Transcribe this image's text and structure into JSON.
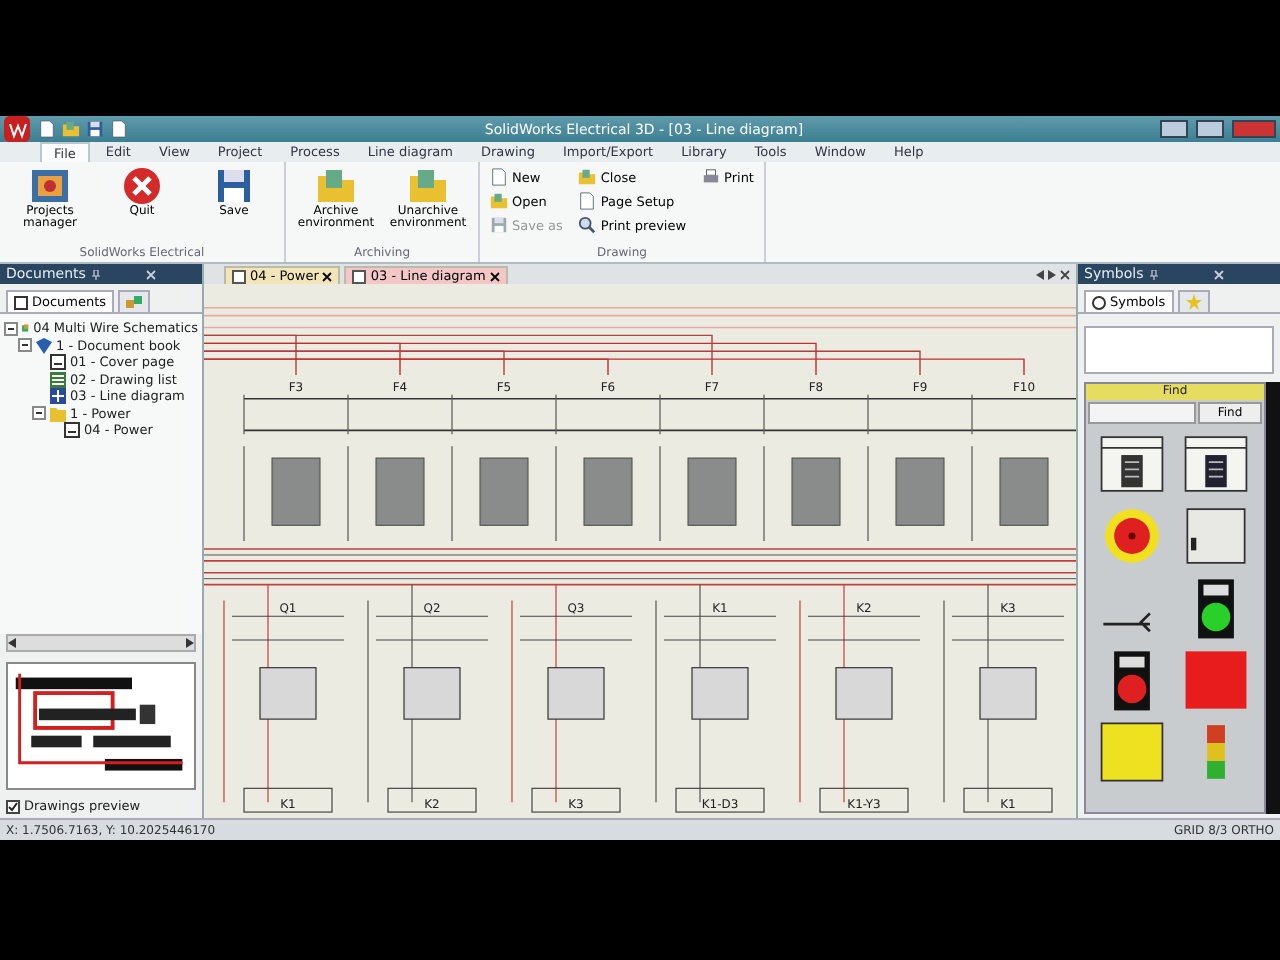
{
  "window": {
    "title": "SolidWorks Electrical 3D - [03 - Line diagram]"
  },
  "menu": [
    {
      "label": "File",
      "selected": true
    },
    {
      "label": "Edit",
      "selected": false
    },
    {
      "label": "View",
      "selected": false
    },
    {
      "label": "Project",
      "selected": false
    },
    {
      "label": "Process",
      "selected": false
    },
    {
      "label": "Line diagram",
      "selected": false
    },
    {
      "label": "Drawing",
      "selected": false
    },
    {
      "label": "Import/Export",
      "selected": false
    },
    {
      "label": "Library",
      "selected": false
    },
    {
      "label": "Tools",
      "selected": false
    },
    {
      "label": "Window",
      "selected": false
    },
    {
      "label": "Help",
      "selected": false
    }
  ],
  "ribbon": {
    "groups": [
      {
        "label": "SolidWorks Electrical",
        "buttons": [
          {
            "label": "Projects manager",
            "kind": "projects",
            "disabled": false
          },
          {
            "label": "Quit",
            "kind": "quit",
            "disabled": false
          },
          {
            "label": "Save",
            "kind": "save",
            "disabled": false
          }
        ]
      },
      {
        "label": "Archiving",
        "buttons": [
          {
            "label": "Archive environment",
            "kind": "archive",
            "disabled": false
          },
          {
            "label": "Unarchive environment",
            "kind": "archive",
            "disabled": false
          }
        ]
      },
      {
        "label": "Drawing",
        "buttons": [
          {
            "label": "New",
            "kind": "new",
            "disabled": false
          },
          {
            "label": "Open",
            "kind": "open",
            "disabled": false
          },
          {
            "label": "Save as",
            "kind": "saveas",
            "disabled": true
          },
          {
            "label": "Close",
            "kind": "close",
            "disabled": false
          },
          {
            "label": "Page Setup",
            "kind": "setup",
            "disabled": false
          },
          {
            "label": "Print preview",
            "kind": "preview",
            "disabled": false
          },
          {
            "label": "Print",
            "kind": "print",
            "disabled": false
          }
        ]
      }
    ]
  },
  "documents_panel": {
    "title": "Documents",
    "tabs": [
      {
        "label": "Documents",
        "selected": true
      },
      {
        "kind": "components",
        "selected": false
      }
    ],
    "tree": [
      {
        "label": "04 Multi Wire Schematics",
        "kind": "project",
        "expanded": true,
        "children": [
          {
            "label": "1 - Document book",
            "kind": "book",
            "expanded": true,
            "children": [
              {
                "label": "01 - Cover page",
                "kind": "page"
              },
              {
                "label": "02 - Drawing list",
                "kind": "list"
              },
              {
                "label": "03 - Line diagram",
                "kind": "diagram"
              },
              {
                "label": "1 - Power",
                "kind": "folder",
                "expanded": true,
                "children": [
                  {
                    "label": "04 - Power",
                    "kind": "page"
                  }
                ]
              }
            ]
          }
        ]
      }
    ],
    "preview_checkbox": {
      "label": "Drawings preview",
      "checked": true
    }
  },
  "document_tabs": [
    {
      "label": "04 - Power",
      "selected": false
    },
    {
      "label": "03 - Line diagram",
      "selected": true
    }
  ],
  "diagram": {
    "top_row": [
      "F3",
      "F4",
      "F5",
      "F6",
      "F7",
      "F8",
      "F9",
      "F10"
    ],
    "lower_row": [
      "Q1",
      "Q2",
      "Q3",
      "K1",
      "K2",
      "K3"
    ],
    "bottom_row": [
      "K1",
      "K2",
      "K3",
      "K1-D3",
      "K1-Y3",
      "K1"
    ]
  },
  "symbols_panel": {
    "title": "Symbols",
    "tabs": [
      {
        "label": "Symbols",
        "selected": true
      },
      {
        "kind": "favorites",
        "selected": false
      }
    ],
    "find_title": "Find",
    "find_button": "Find",
    "symbols": [
      {
        "kind": "contactor"
      },
      {
        "kind": "relay"
      },
      {
        "kind": "emergency-stop"
      },
      {
        "kind": "switch-box"
      },
      {
        "kind": "selector"
      },
      {
        "kind": "green-button"
      },
      {
        "kind": "red-button"
      },
      {
        "kind": "red-lamp"
      },
      {
        "kind": "yellow-lamp"
      },
      {
        "kind": "signal-tower"
      }
    ]
  },
  "status_bar": {
    "coordinates": "X: 1.7506.7163, Y: 10.2025446170",
    "modes": "GRID 8/3   ORTHO"
  }
}
